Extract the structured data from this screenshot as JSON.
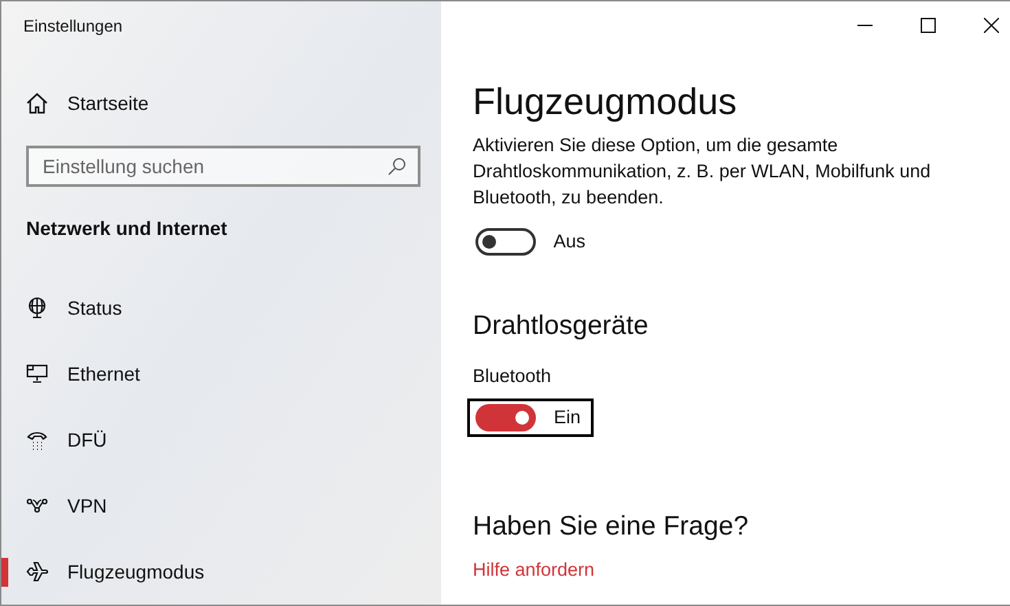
{
  "window": {
    "title": "Einstellungen"
  },
  "sidebar": {
    "home": {
      "label": "Startseite"
    },
    "search": {
      "placeholder": "Einstellung suchen"
    },
    "section": "Netzwerk und Internet",
    "items": [
      {
        "label": "Status",
        "selected": false
      },
      {
        "label": "Ethernet",
        "selected": false
      },
      {
        "label": "DFÜ",
        "selected": false
      },
      {
        "label": "VPN",
        "selected": false
      },
      {
        "label": "Flugzeugmodus",
        "selected": true
      }
    ]
  },
  "main": {
    "title": "Flugzeugmodus",
    "description": "Aktivieren Sie diese Option, um die gesamte Drahtloskommunikation, z. B. per WLAN, Mobilfunk und Bluetooth, zu beenden.",
    "airplane_toggle": {
      "on": false,
      "state_label": "Aus",
      "focused": false
    },
    "section": "Drahtlosgeräte",
    "bluetooth": {
      "label": "Bluetooth",
      "toggle": {
        "on": true,
        "state_label": "Ein",
        "focused": true
      }
    },
    "help_heading": "Haben Sie eine Frage?",
    "help_link": "Hilfe anfordern"
  }
}
